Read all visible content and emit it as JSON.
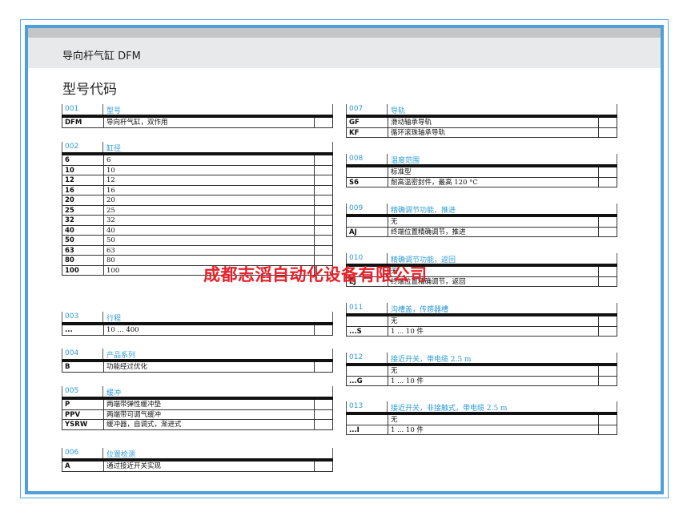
{
  "doc_title": "导向杆气缸 DFM",
  "section_title": "型号代码",
  "watermark": "成都志滔自动化设备有限公司",
  "left_blocks": [
    {
      "code": "001",
      "label": "型号",
      "rows": [
        [
          "DFM",
          "导向杆气缸，双作用"
        ]
      ]
    },
    {
      "code": "002",
      "label": "缸径",
      "rows": [
        [
          "6",
          "6"
        ],
        [
          "10",
          "10"
        ],
        [
          "12",
          "12"
        ],
        [
          "16",
          "16"
        ],
        [
          "20",
          "20"
        ],
        [
          "25",
          "25"
        ],
        [
          "32",
          "32"
        ],
        [
          "40",
          "40"
        ],
        [
          "50",
          "50"
        ],
        [
          "63",
          "63"
        ],
        [
          "80",
          "80"
        ],
        [
          "100",
          "100"
        ]
      ]
    },
    {
      "code": "003",
      "label": "行程",
      "rows": [
        [
          "...",
          "10 ... 400"
        ]
      ]
    },
    {
      "code": "004",
      "label": "产品系列",
      "rows": [
        [
          "B",
          "功能经过优化"
        ]
      ]
    },
    {
      "code": "005",
      "label": "缓冲",
      "rows": [
        [
          "P",
          "两端带弹性缓冲垫"
        ],
        [
          "PPV",
          "两端带可调气缓冲"
        ],
        [
          "YSRW",
          "缓冲器，自调式，渐进式"
        ]
      ]
    },
    {
      "code": "006",
      "label": "位置检测",
      "rows": [
        [
          "A",
          "通过接近开关实现"
        ]
      ]
    }
  ],
  "right_blocks": [
    {
      "code": "007",
      "label": "导轨",
      "rows": [
        [
          "GF",
          "滑动轴承导轨"
        ],
        [
          "KF",
          "循环滚珠轴承导轨"
        ]
      ]
    },
    {
      "code": "008",
      "label": "温度范围",
      "rows": [
        [
          "",
          "标准型"
        ],
        [
          "S6",
          "耐高温密封件，最高 120 °C"
        ]
      ]
    },
    {
      "code": "009",
      "label": "精确调节功能，推进",
      "rows": [
        [
          "",
          "无"
        ],
        [
          "AJ",
          "终端位置精确调节，推进"
        ]
      ]
    },
    {
      "code": "010",
      "label": "精确调节功能，返回",
      "rows": [
        [
          "",
          "无"
        ],
        [
          "EJ",
          "终端位置精确调节，返回"
        ]
      ]
    },
    {
      "code": "011",
      "label": "沟槽盖，传感器槽",
      "rows": [
        [
          "",
          "无"
        ],
        [
          "...S",
          "1 ... 10 件"
        ]
      ]
    },
    {
      "code": "012",
      "label": "接近开关，带电缆 2.5 m",
      "rows": [
        [
          "",
          "无"
        ],
        [
          "...G",
          "1 ... 10 件"
        ]
      ]
    },
    {
      "code": "013",
      "label": "接近开关，非接触式，带电缆 2.5 m",
      "rows": [
        [
          "",
          "无"
        ],
        [
          "...I",
          "1 ... 10 件"
        ]
      ]
    }
  ]
}
